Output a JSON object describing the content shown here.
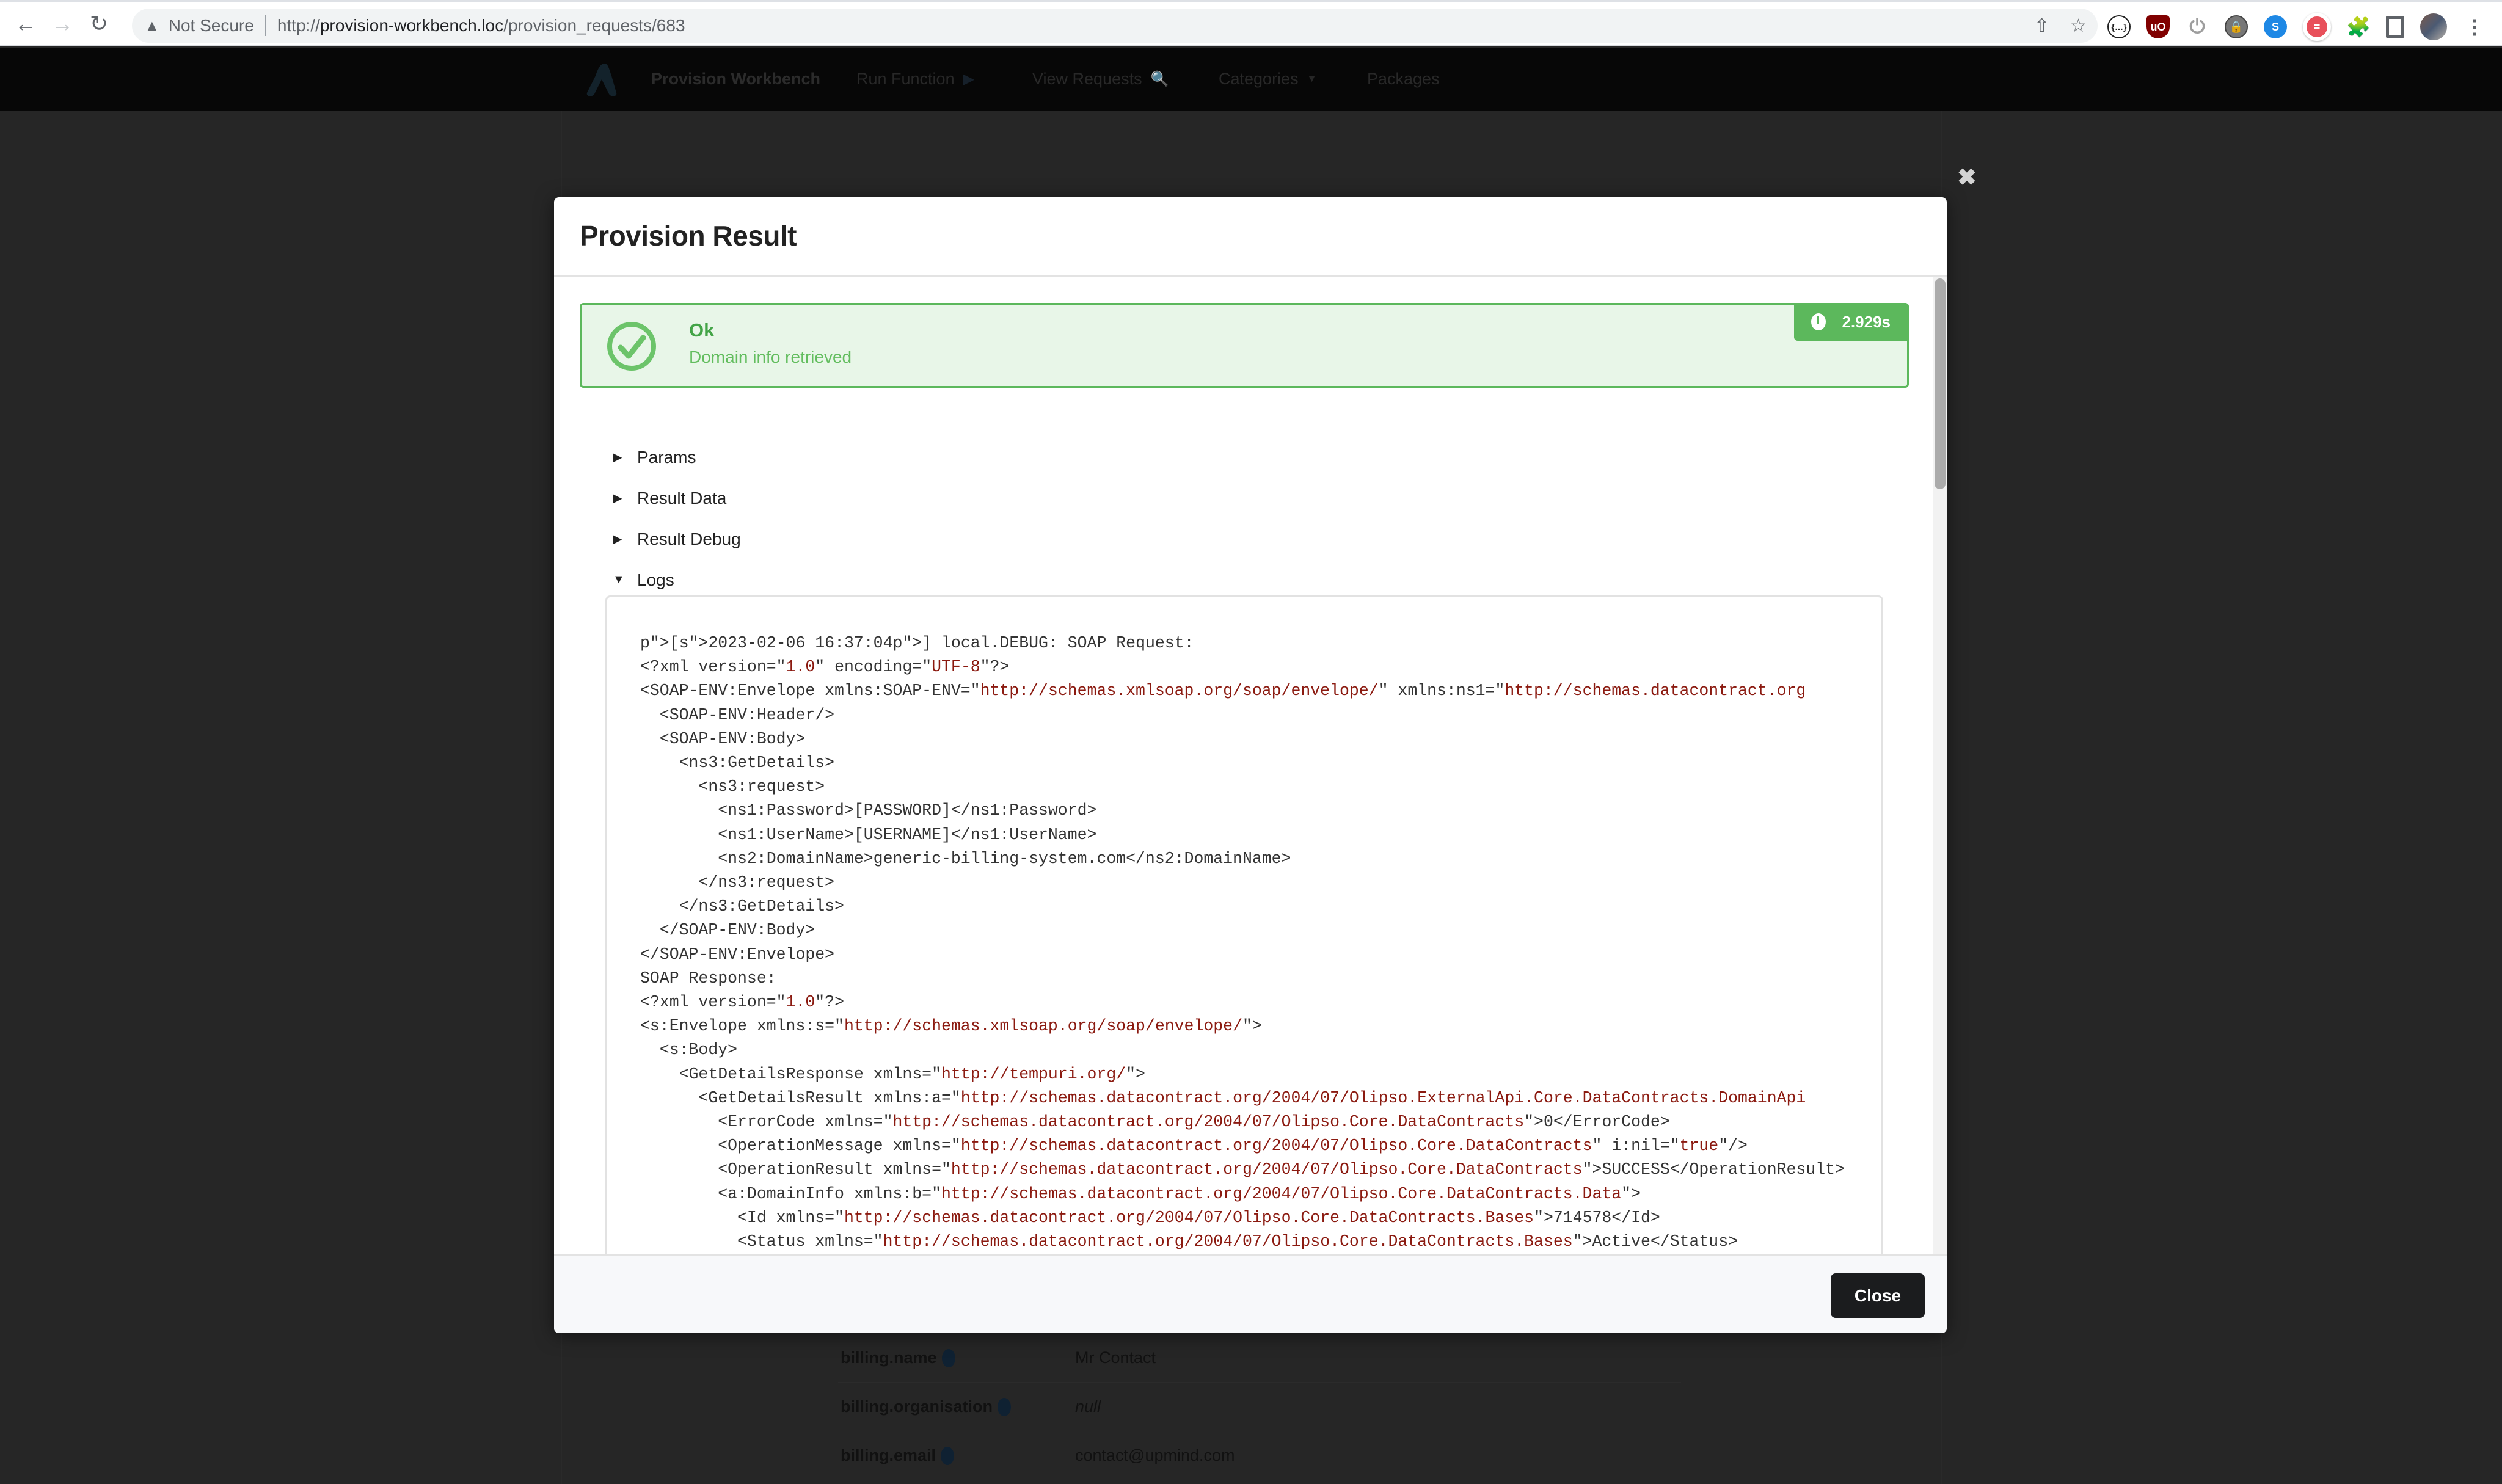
{
  "browser": {
    "security_label": "Not Secure",
    "url_scheme": "http://",
    "url_host": "provision-workbench.loc",
    "url_path": "/provision_requests/683",
    "extensions": [
      "json-viewer",
      "ublock-origin",
      "power",
      "keepass",
      "shazam",
      "todoist",
      "extensions-puzzle",
      "side-panel",
      "profile-avatar",
      "more-menu"
    ]
  },
  "app_nav": {
    "brand": "Provision Workbench",
    "links": [
      {
        "label": "Run Function",
        "icon": "play-circle-icon"
      },
      {
        "label": "View Requests",
        "icon": "search-plus-icon"
      },
      {
        "label": "Categories",
        "icon": "caret-down-icon"
      },
      {
        "label": "Packages",
        "icon": ""
      }
    ]
  },
  "background_table": {
    "rows": [
      {
        "key": "billing.name",
        "value": "Mr Contact"
      },
      {
        "key": "billing.organisation",
        "value": "null"
      },
      {
        "key": "billing.email",
        "value": "contact@upmind.com"
      }
    ]
  },
  "modal": {
    "title": "Provision Result",
    "alert": {
      "status": "Ok",
      "message": "Domain info retrieved",
      "duration": "2.929s",
      "color": "#5cb85c"
    },
    "sections": [
      {
        "label": "Params",
        "expanded": false
      },
      {
        "label": "Result Data",
        "expanded": false
      },
      {
        "label": "Result Debug",
        "expanded": false
      },
      {
        "label": "Logs",
        "expanded": true
      }
    ],
    "logs": {
      "timestamp": "2023-02-06 16:37:04",
      "lines": [
        "[2023-02-06 16:37:04] local.DEBUG: SOAP Request:",
        "<?xml version=\"1.0\" encoding=\"UTF-8\"?>",
        "<SOAP-ENV:Envelope xmlns:SOAP-ENV=\"http://schemas.xmlsoap.org/soap/envelope/\" xmlns:ns1=\"http://schemas.datacontract.org",
        "  <SOAP-ENV:Header/>",
        "  <SOAP-ENV:Body>",
        "    <ns3:GetDetails>",
        "      <ns3:request>",
        "        <ns1:Password>[PASSWORD]</ns1:Password>",
        "        <ns1:UserName>[USERNAME]</ns1:UserName>",
        "        <ns2:DomainName>generic-billing-system.com</ns2:DomainName>",
        "      </ns3:request>",
        "    </ns3:GetDetails>",
        "  </SOAP-ENV:Body>",
        "</SOAP-ENV:Envelope>",
        "SOAP Response:",
        "<?xml version=\"1.0\"?>",
        "<s:Envelope xmlns:s=\"http://schemas.xmlsoap.org/soap/envelope/\">",
        "  <s:Body>",
        "    <GetDetailsResponse xmlns=\"http://tempuri.org/\">",
        "      <GetDetailsResult xmlns:a=\"http://schemas.datacontract.org/2004/07/Olipso.ExternalApi.Core.DataContracts.DomainApi",
        "        <ErrorCode xmlns=\"http://schemas.datacontract.org/2004/07/Olipso.Core.DataContracts\">0</ErrorCode>",
        "        <OperationMessage xmlns=\"http://schemas.datacontract.org/2004/07/Olipso.Core.DataContracts\" i:nil=\"true\"/>",
        "        <OperationResult xmlns=\"http://schemas.datacontract.org/2004/07/Olipso.Core.DataContracts\">SUCCESS</OperationResult>",
        "        <a:DomainInfo xmlns:b=\"http://schemas.datacontract.org/2004/07/Olipso.Core.DataContracts.Data\">",
        "          <Id xmlns=\"http://schemas.datacontract.org/2004/07/Olipso.Core.DataContracts.Bases\">714578</Id>",
        "          <Status xmlns=\"http://schemas.datacontract.org/2004/07/Olipso.Core.DataContracts.Bases\">Active</Status>"
      ]
    },
    "close_button": "Close",
    "overlay_close_icon": "close-icon"
  }
}
